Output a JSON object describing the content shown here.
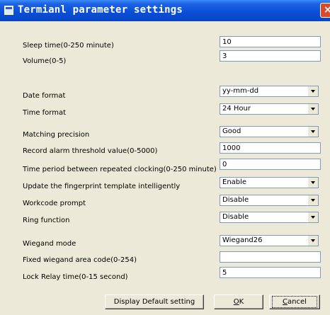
{
  "window": {
    "title": "Termianl parameter settings",
    "close_glyph": "×"
  },
  "fields": [
    {
      "label": "Sleep time(0-250 minute)",
      "value": "10"
    },
    {
      "label": "Volume(0-5)",
      "value": "3"
    },
    {
      "label": "Date format",
      "value": "yy-mm-dd"
    },
    {
      "label": "Time format",
      "value": "24 Hour"
    },
    {
      "label": "Matching precision",
      "value": "Good"
    },
    {
      "label": "Record alarm threshold value(0-5000)",
      "value": "1000"
    },
    {
      "label": "Time period between repeated clocking(0-250 minute)",
      "value": "0"
    },
    {
      "label": "Update the fingerprint template intelligently",
      "value": "Enable"
    },
    {
      "label": "Workcode prompt",
      "value": "Disable"
    },
    {
      "label": "Ring function",
      "value": "Disable"
    },
    {
      "label": "Wiegand mode",
      "value": "Wiegand26"
    },
    {
      "label": "Fixed wiegand area code(0-254)",
      "value": ""
    },
    {
      "label": "Lock Relay time(0-15 second)",
      "value": "5"
    }
  ],
  "buttons": {
    "default_label": "Display Default setting",
    "ok_mnemonic": "O",
    "ok_rest": "K",
    "cancel_mnemonic": "C",
    "cancel_rest": "ancel"
  }
}
